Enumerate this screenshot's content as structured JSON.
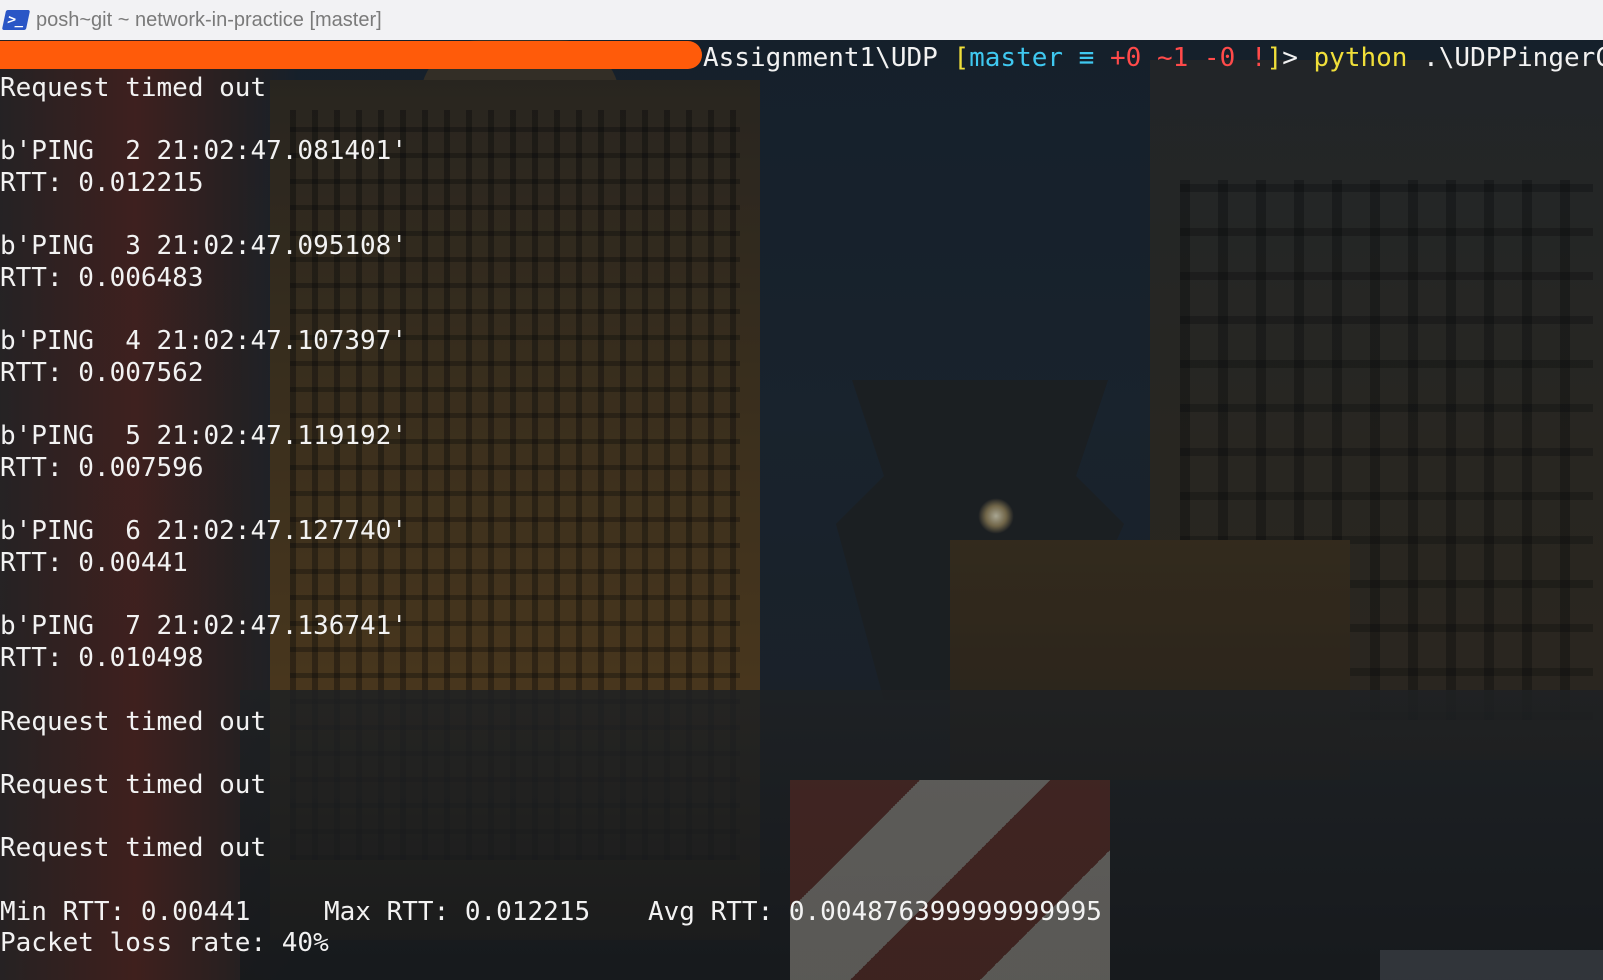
{
  "window": {
    "title": "posh~git ~ network-in-practice [master]"
  },
  "prompt": {
    "path": "Assignment1\\UDP ",
    "bracket_open": "[",
    "branch": "master",
    "branch_status": " ≡",
    "added": " +0",
    "modified": " ~1",
    "deleted": " -0",
    "bang": " !",
    "bracket_close": "]",
    "gt": "> ",
    "command": "python",
    "args": " .\\UDPPingerClient.py"
  },
  "output": [
    "Request timed out",
    "b'PING  2 21:02:47.081401'",
    "RTT: 0.012215",
    "b'PING  3 21:02:47.095108'",
    "RTT: 0.006483",
    "b'PING  4 21:02:47.107397'",
    "RTT: 0.007562",
    "b'PING  5 21:02:47.119192'",
    "RTT: 0.007596",
    "b'PING  6 21:02:47.127740'",
    "RTT: 0.00441",
    "b'PING  7 21:02:47.136741'",
    "RTT: 0.010498",
    "Request timed out",
    "Request timed out",
    "Request timed out"
  ],
  "summary": {
    "min_rtt": "Min RTT: 0.00441",
    "max_rtt": "Max RTT: 0.012215",
    "avg_rtt": "Avg RTT: 0.004876399999999995",
    "loss_rate": "Packet loss rate: 40%"
  },
  "colors": {
    "redaction": "#ff5b0a",
    "branch": "#3fc8f0",
    "bracket": "#f0df3a",
    "status_changes": "#ff4a4a",
    "command": "#f0df3a"
  }
}
